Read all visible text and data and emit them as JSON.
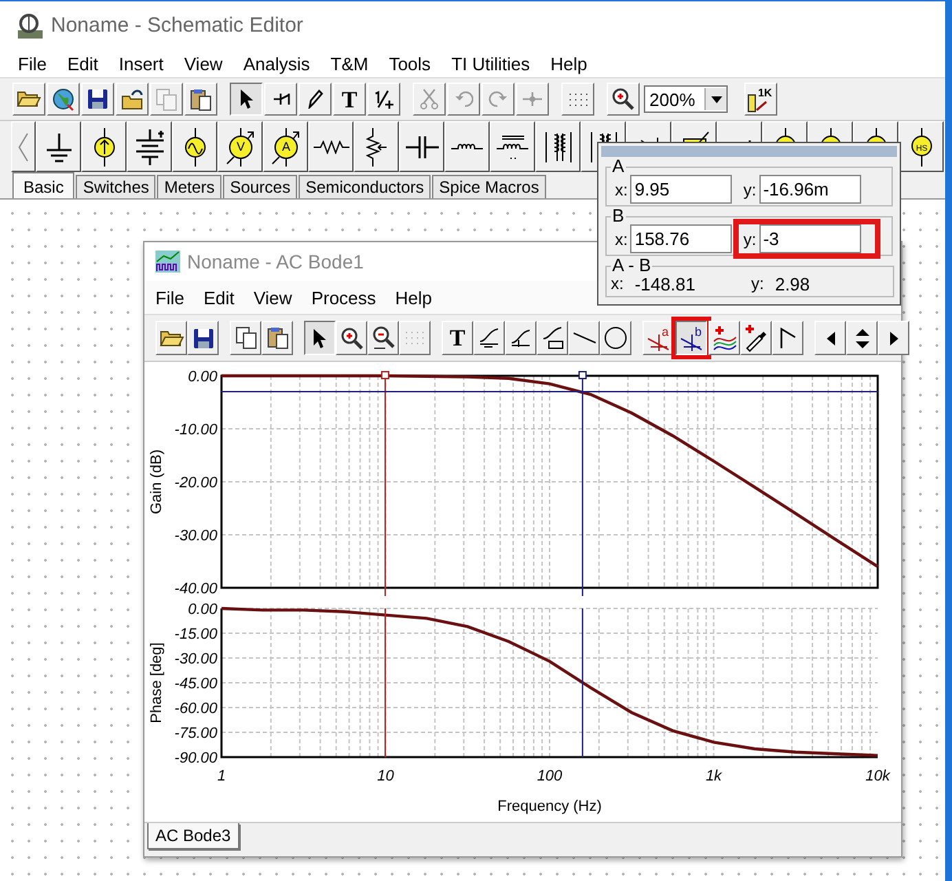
{
  "window": {
    "title": "Noname - Schematic Editor"
  },
  "menu": [
    "File",
    "Edit",
    "Insert",
    "View",
    "Analysis",
    "T&M",
    "Tools",
    "TI Utilities",
    "Help"
  ],
  "toolbar": [
    {
      "kind": "open",
      "pressed": false,
      "disabled": false
    },
    {
      "kind": "globe",
      "pressed": false,
      "disabled": false
    },
    {
      "kind": "save",
      "pressed": false,
      "disabled": false
    },
    {
      "kind": "open-project",
      "pressed": false,
      "disabled": false
    },
    {
      "kind": "copy",
      "pressed": false,
      "disabled": true
    },
    {
      "kind": "paste",
      "pressed": false,
      "disabled": false
    },
    {
      "kind": "separator"
    },
    {
      "kind": "pointer",
      "pressed": true,
      "disabled": false
    },
    {
      "kind": "wire",
      "pressed": false,
      "disabled": false
    },
    {
      "kind": "pencil",
      "pressed": false,
      "disabled": false
    },
    {
      "kind": "text",
      "label": "T",
      "pressed": false,
      "disabled": false
    },
    {
      "kind": "fraction",
      "pressed": false,
      "disabled": false
    },
    {
      "kind": "separator"
    },
    {
      "kind": "cut",
      "pressed": false,
      "disabled": true
    },
    {
      "kind": "undo",
      "pressed": false,
      "disabled": true
    },
    {
      "kind": "redo",
      "pressed": false,
      "disabled": true
    },
    {
      "kind": "junction",
      "pressed": false,
      "disabled": true
    },
    {
      "kind": "separator"
    },
    {
      "kind": "grid",
      "pressed": false,
      "disabled": false
    },
    {
      "kind": "separator"
    },
    {
      "kind": "zoom-in",
      "pressed": false,
      "disabled": false
    },
    {
      "kind": "combo",
      "value": "200%"
    },
    {
      "kind": "resistor-label",
      "label": "1K",
      "pressed": false,
      "disabled": false
    }
  ],
  "component_bar": [
    {
      "kind": "scroll-left"
    },
    {
      "kind": "ground"
    },
    {
      "kind": "current-source"
    },
    {
      "kind": "battery"
    },
    {
      "kind": "ac-source"
    },
    {
      "kind": "meter",
      "label": "V"
    },
    {
      "kind": "meter",
      "label": "A"
    },
    {
      "kind": "resistor"
    },
    {
      "kind": "potentiometer"
    },
    {
      "kind": "capacitor"
    },
    {
      "kind": "inductor"
    },
    {
      "kind": "core-inductor"
    },
    {
      "kind": "transformer"
    },
    {
      "kind": "transformer"
    },
    {
      "kind": "diode"
    },
    {
      "kind": "variable"
    },
    {
      "kind": "bracket"
    },
    {
      "kind": "yellow-source"
    },
    {
      "kind": "yellow-source"
    },
    {
      "kind": "yellow-source"
    },
    {
      "kind": "yellow-source",
      "label": "HS"
    }
  ],
  "component_tabs": [
    {
      "label": "Basic",
      "selected": true
    },
    {
      "label": "Switches",
      "selected": false
    },
    {
      "label": "Meters",
      "selected": false
    },
    {
      "label": "Sources",
      "selected": false
    },
    {
      "label": "Semiconductors",
      "selected": false
    },
    {
      "label": "Spice Macros",
      "selected": false
    }
  ],
  "bode_window": {
    "title": "Noname - AC Bode1",
    "menu": [
      "File",
      "Edit",
      "View",
      "Process",
      "Help"
    ],
    "toolbar": [
      {
        "kind": "open",
        "pressed": false,
        "disabled": false,
        "highlighted": false
      },
      {
        "kind": "save",
        "pressed": false,
        "disabled": false,
        "highlighted": false
      },
      {
        "kind": "separator"
      },
      {
        "kind": "copy",
        "pressed": false,
        "disabled": false,
        "highlighted": false
      },
      {
        "kind": "paste",
        "pressed": false,
        "disabled": false,
        "highlighted": false
      },
      {
        "kind": "separator"
      },
      {
        "kind": "pointer",
        "pressed": true,
        "disabled": false,
        "highlighted": false
      },
      {
        "kind": "zoom-in",
        "pressed": false,
        "disabled": false,
        "highlighted": false
      },
      {
        "kind": "zoom-out",
        "pressed": false,
        "disabled": false,
        "highlighted": false
      },
      {
        "kind": "grid",
        "pressed": false,
        "disabled": true,
        "highlighted": false
      },
      {
        "kind": "separator"
      },
      {
        "kind": "text",
        "label": "T",
        "pressed": false,
        "disabled": false,
        "highlighted": false
      },
      {
        "kind": "curve-x",
        "pressed": false,
        "disabled": false,
        "highlighted": false
      },
      {
        "kind": "curve-q",
        "pressed": false,
        "disabled": false,
        "highlighted": false
      },
      {
        "kind": "curve-table",
        "pressed": false,
        "disabled": false,
        "highlighted": false
      },
      {
        "kind": "line",
        "pressed": false,
        "disabled": false,
        "highlighted": false
      },
      {
        "kind": "circle",
        "pressed": false,
        "disabled": false,
        "highlighted": false
      },
      {
        "kind": "separator"
      },
      {
        "kind": "cursor-a",
        "label": "a",
        "pressed": false,
        "disabled": false,
        "highlighted": false
      },
      {
        "kind": "cursor-b",
        "label": "b",
        "pressed": true,
        "disabled": false,
        "highlighted": true
      },
      {
        "kind": "traces",
        "pressed": false,
        "disabled": false,
        "highlighted": false
      },
      {
        "kind": "picker",
        "pressed": false,
        "disabled": false,
        "highlighted": false
      },
      {
        "kind": "marker",
        "pressed": false,
        "disabled": false,
        "highlighted": false
      },
      {
        "kind": "separator"
      },
      {
        "kind": "left",
        "pressed": false,
        "disabled": false,
        "highlighted": false
      },
      {
        "kind": "updown",
        "pressed": false,
        "disabled": false,
        "highlighted": false
      },
      {
        "kind": "right",
        "pressed": false,
        "disabled": false,
        "highlighted": false
      }
    ],
    "gain_plot": {
      "chart_data": {
        "type": "line",
        "ylabel": "Gain (dB)",
        "grid": true,
        "series": [
          {
            "color": "#6b1010",
            "values": [
              0,
              0,
              0,
              0,
              0,
              -0.1,
              -0.2,
              -0.5,
              -1.5,
              -3.5,
              -7,
              -11.3,
              -16.1,
              -21,
              -26,
              -31,
              -36
            ]
          }
        ],
        "ylim": [
          -40,
          0
        ],
        "yticks": [
          {
            "value": 0,
            "label": "0.00"
          },
          {
            "value": -10,
            "label": "-10.00"
          },
          {
            "value": -20,
            "label": "-20.00"
          },
          {
            "value": -30,
            "label": "-30.00"
          },
          {
            "value": -40,
            "label": "-40.00"
          }
        ]
      }
    },
    "phase_plot": {
      "chart_data": {
        "type": "line",
        "xlabel": "Frequency (Hz)",
        "ylabel": "Phase [deg]",
        "grid": true,
        "categories": [
          "1",
          null,
          null,
          null,
          "10",
          null,
          null,
          null,
          "100",
          null,
          null,
          null,
          "1k",
          null,
          null,
          null,
          "10k"
        ],
        "series": [
          {
            "color": "#6b1010",
            "values": [
              0,
              -1,
              -1,
              -2,
              -4,
              -6,
              -11,
              -20,
              -32,
              -48,
              -63,
              -74,
              -81,
              -85,
              -87,
              -88,
              -89
            ]
          }
        ],
        "ylim": [
          -90,
          0
        ],
        "yticks": [
          {
            "value": 0,
            "label": "0.00"
          },
          {
            "value": -15,
            "label": "-15.00"
          },
          {
            "value": -30,
            "label": "-30.00"
          },
          {
            "value": -45,
            "label": "-45.00"
          },
          {
            "value": -60,
            "label": "-60.00"
          },
          {
            "value": -75,
            "label": "-75.00"
          },
          {
            "value": -90,
            "label": "-90.00"
          }
        ]
      }
    },
    "tabs": [
      {
        "label": "AC Bode3",
        "selected": true
      }
    ]
  },
  "cursor_panel": {
    "groups": [
      {
        "title": "A",
        "color": "#c02020",
        "fields": [
          {
            "label": "x:",
            "value": "9.95",
            "highlighted": false
          },
          {
            "label": "y:",
            "value": "-16.96m",
            "highlighted": false
          }
        ]
      },
      {
        "title": "B",
        "color": "#202080",
        "fields": [
          {
            "label": "x:",
            "value": "158.76",
            "highlighted": false
          },
          {
            "label": "y:",
            "value": "-3",
            "highlighted": true
          }
        ]
      }
    ],
    "difference": {
      "title": "A - B",
      "fields": [
        {
          "label": "x:",
          "value": "-148.81"
        },
        {
          "label": "y:",
          "value": "2.98"
        }
      ]
    }
  }
}
